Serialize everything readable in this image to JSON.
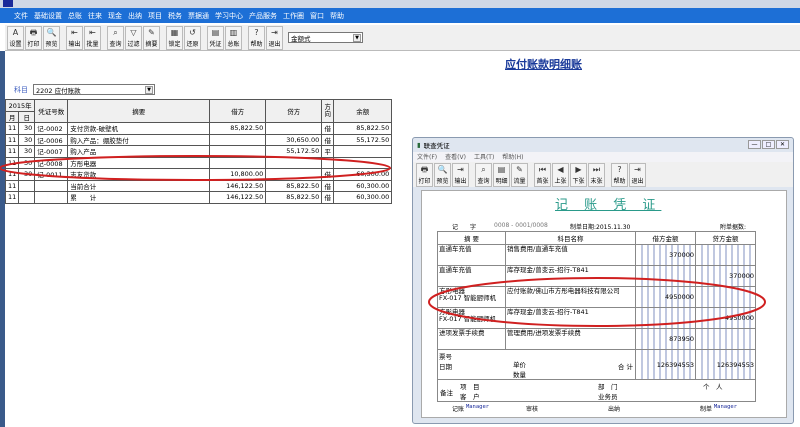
{
  "menu": [
    "文件",
    "基础设置",
    "总账",
    "往来",
    "现金",
    "出纳",
    "项目",
    "税务",
    "票据通",
    "学习中心",
    "产品服务",
    "工作圈",
    "窗口",
    "帮助"
  ],
  "toolbar": [
    {
      "icon": "A",
      "label": "设置"
    },
    {
      "icon": "🖶",
      "label": "打印"
    },
    {
      "icon": "🔍",
      "label": "预览"
    },
    {
      "icon": "⇤",
      "label": "输出"
    },
    {
      "icon": "⇤",
      "label": "批量"
    },
    {
      "icon": "⌕",
      "label": "查询"
    },
    {
      "icon": "▽",
      "label": "过滤"
    },
    {
      "icon": "✎",
      "label": "摘要"
    },
    {
      "icon": "▦",
      "label": "锁定"
    },
    {
      "icon": "↺",
      "label": "还原"
    },
    {
      "icon": "▤",
      "label": "凭证"
    },
    {
      "icon": "▥",
      "label": "总账"
    },
    {
      "icon": "?",
      "label": "帮助"
    },
    {
      "icon": "⇥",
      "label": "退出"
    }
  ],
  "format_select": "金额式",
  "page_title": "应付账款明细账",
  "subject_label": "科目",
  "subject_value": "2202 应付账款",
  "table": {
    "year": "2015年",
    "month": "月",
    "day": "日",
    "voucher": "凭证号数",
    "summary": "摘要",
    "debit": "借方",
    "credit": "贷方",
    "direction": "方向",
    "balance": "余额",
    "rows": [
      [
        "11",
        "30",
        "记-0002",
        "支付货款-破壁机",
        "85,822.50",
        "",
        "借",
        "85,822.50"
      ],
      [
        "11",
        "30",
        "记-0006",
        "购入产品：绷胶垫付",
        "",
        "30,650.00",
        "借",
        "55,172.50"
      ],
      [
        "11",
        "30",
        "记-0007",
        "购入产品",
        "",
        "55,172.50",
        "平",
        ""
      ],
      [
        "11",
        "30",
        "记-0008",
        "方彤电器",
        "",
        "",
        "",
        ""
      ],
      [
        "11",
        "30",
        "记-0011",
        "志友货款",
        "10,800.00",
        "",
        "借",
        "60,300.00"
      ],
      [
        "11",
        "",
        "",
        "当前合计",
        "146,122.50",
        "85,822.50",
        "借",
        "60,300.00"
      ],
      [
        "11",
        "",
        "",
        "累　　计",
        "146,122.50",
        "85,822.50",
        "借",
        "60,300.00"
      ]
    ]
  },
  "popup": {
    "title": "联查凭证",
    "menu": [
      "文件(F)",
      "查看(V)",
      "工具(T)",
      "帮助(H)"
    ],
    "toolbar": [
      {
        "icon": "🖶",
        "label": "打印"
      },
      {
        "icon": "🔍",
        "label": "预览"
      },
      {
        "icon": "⇥",
        "label": "输出"
      },
      {
        "icon": "⌕",
        "label": "查询"
      },
      {
        "icon": "▤",
        "label": "明细"
      },
      {
        "icon": "✎",
        "label": "流量"
      },
      {
        "icon": "⏮",
        "label": "首张"
      },
      {
        "icon": "◀",
        "label": "上张"
      },
      {
        "icon": "▶",
        "label": "下张"
      },
      {
        "icon": "⏭",
        "label": "末张"
      },
      {
        "icon": "?",
        "label": "帮助"
      },
      {
        "icon": "⇥",
        "label": "退出"
      }
    ],
    "voucher_title": "记 账 凭 证",
    "word": "记　　字",
    "number": "0008 - 0001/0008",
    "date": "制单日期:2015.11.30",
    "attach": "附单据数:",
    "headers": [
      "摘 要",
      "科目名称",
      "借方金额",
      "贷方金额"
    ],
    "rows": [
      [
        "直通车充值",
        "销售费用/直通车充值",
        "370000",
        ""
      ],
      [
        "直通车充值",
        "库存现金/曾变云-招行-T841",
        "",
        "370000"
      ],
      [
        "方彤电器\nFX-017 智能厨师机",
        "应付账款/佛山市方彤电器科技有限公司",
        "4950000",
        ""
      ],
      [
        "方彤电器\nFX-017 智能厨师机",
        "库存现金/曾变云-招行-T841",
        "",
        "4950000"
      ],
      [
        "进项发票手续费",
        "管理费用/进项发票手续费",
        "873950",
        ""
      ]
    ],
    "ticket": "票号",
    "date_label": "日期",
    "price": "单价",
    "qty": "数量",
    "total_label": "合 计",
    "total_debit": "126394553",
    "total_credit": "126394553",
    "remark": "备注",
    "project": "项　目",
    "customer": "客　户",
    "dept": "部　门",
    "staff": "业务员",
    "person": "个　人",
    "footer": {
      "bookkeep": "记账",
      "bookkeeper": "Manager",
      "audit": "审核",
      "cashier": "出纳",
      "maker_label": "制单",
      "maker": "Manager"
    }
  }
}
